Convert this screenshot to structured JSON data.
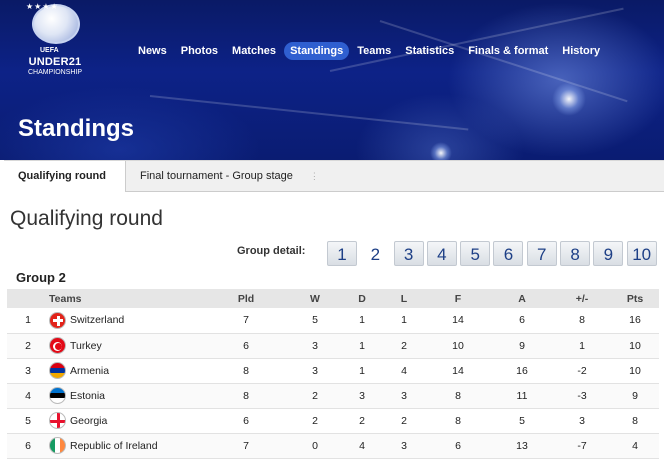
{
  "brand": {
    "stars": "★★★★",
    "org": "UEFA",
    "name": "UNDER21",
    "subtitle": "CHAMPIONSHIP"
  },
  "nav": [
    {
      "label": "News",
      "active": false
    },
    {
      "label": "Photos",
      "active": false
    },
    {
      "label": "Matches",
      "active": false
    },
    {
      "label": "Standings",
      "active": true
    },
    {
      "label": "Teams",
      "active": false
    },
    {
      "label": "Statistics",
      "active": false
    },
    {
      "label": "Finals & format",
      "active": false
    },
    {
      "label": "History",
      "active": false
    }
  ],
  "page_title": "Standings",
  "tabs": [
    {
      "label": "Qualifying round",
      "active": true
    },
    {
      "label": "Final tournament - Group stage",
      "active": false
    }
  ],
  "tab_separator": "⋮",
  "section_title": "Qualifying round",
  "group_detail": {
    "label": "Group detail:",
    "groups": [
      "1",
      "2",
      "3",
      "4",
      "5",
      "6",
      "7",
      "8",
      "9",
      "10"
    ],
    "current": "2"
  },
  "group_name": "Group 2",
  "table": {
    "headers": {
      "rank": "",
      "teams": "Teams",
      "pld": "Pld",
      "w": "W",
      "d": "D",
      "l": "L",
      "f": "F",
      "a": "A",
      "diff": "+/-",
      "pts": "Pts"
    },
    "rows": [
      {
        "rank": "1",
        "team": "Switzerland",
        "flag": "switzerland-flag-icon",
        "pld": "7",
        "w": "5",
        "d": "1",
        "l": "1",
        "f": "14",
        "a": "6",
        "diff": "8",
        "pts": "16"
      },
      {
        "rank": "2",
        "team": "Turkey",
        "flag": "turkey-flag-icon",
        "pld": "6",
        "w": "3",
        "d": "1",
        "l": "2",
        "f": "10",
        "a": "9",
        "diff": "1",
        "pts": "10"
      },
      {
        "rank": "3",
        "team": "Armenia",
        "flag": "armenia-flag-icon",
        "pld": "8",
        "w": "3",
        "d": "1",
        "l": "4",
        "f": "14",
        "a": "16",
        "diff": "-2",
        "pts": "10"
      },
      {
        "rank": "4",
        "team": "Estonia",
        "flag": "estonia-flag-icon",
        "pld": "8",
        "w": "2",
        "d": "3",
        "l": "3",
        "f": "8",
        "a": "11",
        "diff": "-3",
        "pts": "9"
      },
      {
        "rank": "5",
        "team": "Georgia",
        "flag": "georgia-flag-icon",
        "pld": "6",
        "w": "2",
        "d": "2",
        "l": "2",
        "f": "8",
        "a": "5",
        "diff": "3",
        "pts": "8"
      },
      {
        "rank": "6",
        "team": "Republic of Ireland",
        "flag": "ireland-flag-icon",
        "pld": "7",
        "w": "0",
        "d": "4",
        "l": "3",
        "f": "6",
        "a": "13",
        "diff": "-7",
        "pts": "4"
      }
    ]
  },
  "colors": {
    "header_bg": "#0d2287",
    "nav_active": "#2f5fd0",
    "group_button_text": "#1d3f86"
  }
}
